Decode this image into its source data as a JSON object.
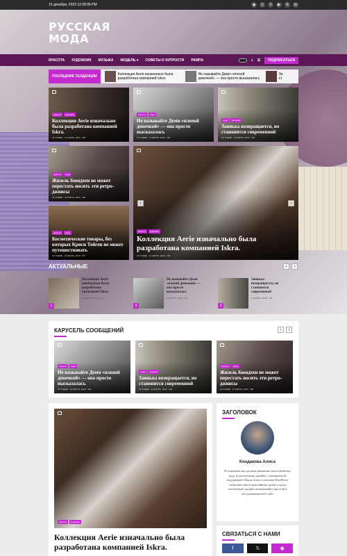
{
  "topbar": {
    "date": "15 декабря, 2023 12:28:06 PM",
    "social": [
      "◉",
      "𝕏",
      "⌾",
      "▶",
      "✆",
      "in"
    ]
  },
  "brand": {
    "line1": "РУССКАЯ",
    "line2": "МОДА"
  },
  "nav": {
    "items": [
      "КРАСОТА",
      "ХУДОЖНИК",
      "МУЗЫКА",
      "МОДЕЛЬ ▾",
      "СОВЕТЫ И ХИТРОСТИ",
      "РАМПА"
    ],
    "subscribe": "ПОДПИСАТЬСЯ"
  },
  "trending": {
    "label": "ПОСЛЕДНИЕ ТЕНДЕНЦИИ",
    "items": [
      "Коллекция Aerie изначально была разработана компанией Iskra.",
      "Не называйте Деми «плохой девочкой» — она просто высказалась",
      "За ст"
    ]
  },
  "cards": [
    {
      "title": "Коллекция Aerie изначально была разработана компанией Iskra.",
      "tags": [
        "красота",
        "художник"
      ],
      "meta": "AF THEME · 13 МАРТА, 2018 · 409"
    },
    {
      "title": "Не называйте Деми «плохой девочкой» — она просто высказалась",
      "tags": [
        "красота",
        "мода"
      ],
      "meta": "AF THEME · 13 МАРТА, 2018 · 409"
    },
    {
      "title": "Заинька возвращается, но становится современной",
      "tags": [
        "мода",
        "уличный"
      ],
      "meta": "AF THEME · 13 МАРТА, 2018 · 349"
    },
    {
      "title": "Жизель Бюндхен не может перестать носить эти ретро-джинсы",
      "tags": [
        "красота",
        "мода"
      ],
      "meta": "AF THEME · 13 МАРТА, 2018 · 406"
    },
    {
      "title": "Коллекция Aerie изначально была разработана компанией Iskra.",
      "tags": [
        "красота",
        "художник"
      ],
      "meta": "AF THEME · 13 МАРТА, 2018 · 409"
    },
    {
      "title": "Косметические товары, без которых Криси Тейген не может путешествовать",
      "tags": [
        "красота",
        "мода"
      ],
      "meta": "AF THEME · 13 МАРТА, 2018 · 377"
    }
  ],
  "actual": {
    "title": "АКТУАЛЬНЫЕ",
    "items": [
      {
        "num": "1",
        "title": "Коллекция Aerie изначально была разработана компанией Iskra.",
        "date": "13 МАРТА, 2018 · 409"
      },
      {
        "num": "2",
        "title": "Не называйте Деми «плохой девочкой» — она просто высказалась",
        "date": "13 МАРТА, 2018 · 349"
      },
      {
        "num": "3",
        "title": "Заинька возвращается, но становится современной",
        "date": "13 МАРТА, 2018 · 349"
      }
    ]
  },
  "carousel": {
    "title": "КАРУСЕЛЬ СООБЩЕНИЙ",
    "items": [
      {
        "title": "Не называйте Деми «плохой девочкой» — она просто высказалась",
        "tags": [
          "красота",
          "мода"
        ],
        "meta": "AF THEME · 13 МАРТА, 2018 · 349"
      },
      {
        "title": "Заинька возвращается, но становится современной",
        "tags": [
          "мода",
          "уличный"
        ],
        "meta": "AF THEME · 13 МАРТА, 2018 · 349"
      },
      {
        "title": "Жизель Бюндхен не может перестать носить эти ретро-джинсы",
        "tags": [
          "красота",
          "мода"
        ],
        "meta": "AF THEME · 13 МАРТА, 2018 · 406"
      }
    ]
  },
  "main_post": {
    "title": "Коллекция Aerie изначально была разработана компанией Iskra.",
    "tags": [
      "красота",
      "художник"
    ]
  },
  "sidebar": {
    "heading": "ЗАГОЛОВОК",
    "name": "Кондакова Алиса",
    "bio": "В основном мы уделяем внимание качественному коду и элегантному дизайну с невероятной поддержкой. Наши темы и плагины WordPress позволяют вам в кратчайшие сроки создать элегантный, профессиональный и простой в обслуживании веб-сайт.",
    "connect": "СВЯЗАТЬСЯ С НАМИ",
    "connect_icons": [
      "f",
      "𝕏",
      "◉"
    ]
  },
  "colors": {
    "accent": "#c32bd1",
    "nav": "#5c1757"
  }
}
